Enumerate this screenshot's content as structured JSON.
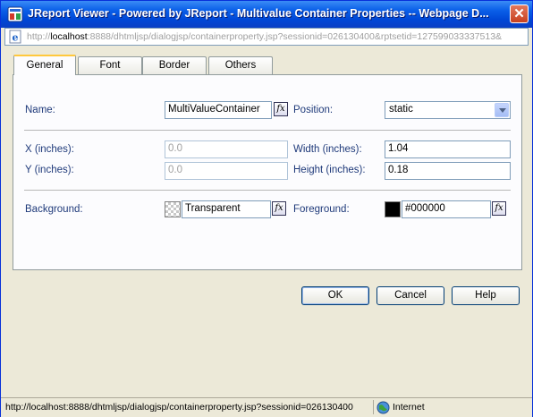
{
  "window": {
    "title": "JReport Viewer - Powered by JReport - Multivalue Container Properties -- Webpage D...",
    "close_label": "✕",
    "icons": {
      "title": "jreport-icon",
      "close": "close-icon"
    }
  },
  "address_bar": {
    "host_prefix": "http://",
    "host": "localhost",
    "path": ":8888/dhtmljsp/dialogjsp/containerproperty.jsp?sessionid=026130400&rptsetid=127599033337513&"
  },
  "tabs": [
    {
      "label": "General",
      "active": true
    },
    {
      "label": "Font",
      "active": false
    },
    {
      "label": "Border",
      "active": false
    },
    {
      "label": "Others",
      "active": false
    }
  ],
  "general": {
    "name_label": "Name:",
    "name_value": "MultiValueContainer",
    "position_label": "Position:",
    "position_value": "static",
    "x_label": "X (inches):",
    "x_value": "0.0",
    "y_label": "Y (inches):",
    "y_value": "0.0",
    "width_label": "Width (inches):",
    "width_value": "1.04",
    "height_label": "Height (inches):",
    "height_value": "0.18",
    "background_label": "Background:",
    "background_value": "Transparent",
    "foreground_label": "Foreground:",
    "foreground_value": "#000000",
    "fx_label": "fx"
  },
  "buttons": {
    "ok": "OK",
    "cancel": "Cancel",
    "help": "Help"
  },
  "status_bar": {
    "url": "http://localhost:8888/dhtmljsp/dialogjsp/containerproperty.jsp?sessionid=026130400",
    "zone": "Internet"
  },
  "colors": {
    "title_bar": "#0a5fe8",
    "tab_highlight": "#ffc83c",
    "label_text": "#1f3a7a",
    "foreground_swatch": "#000000"
  }
}
